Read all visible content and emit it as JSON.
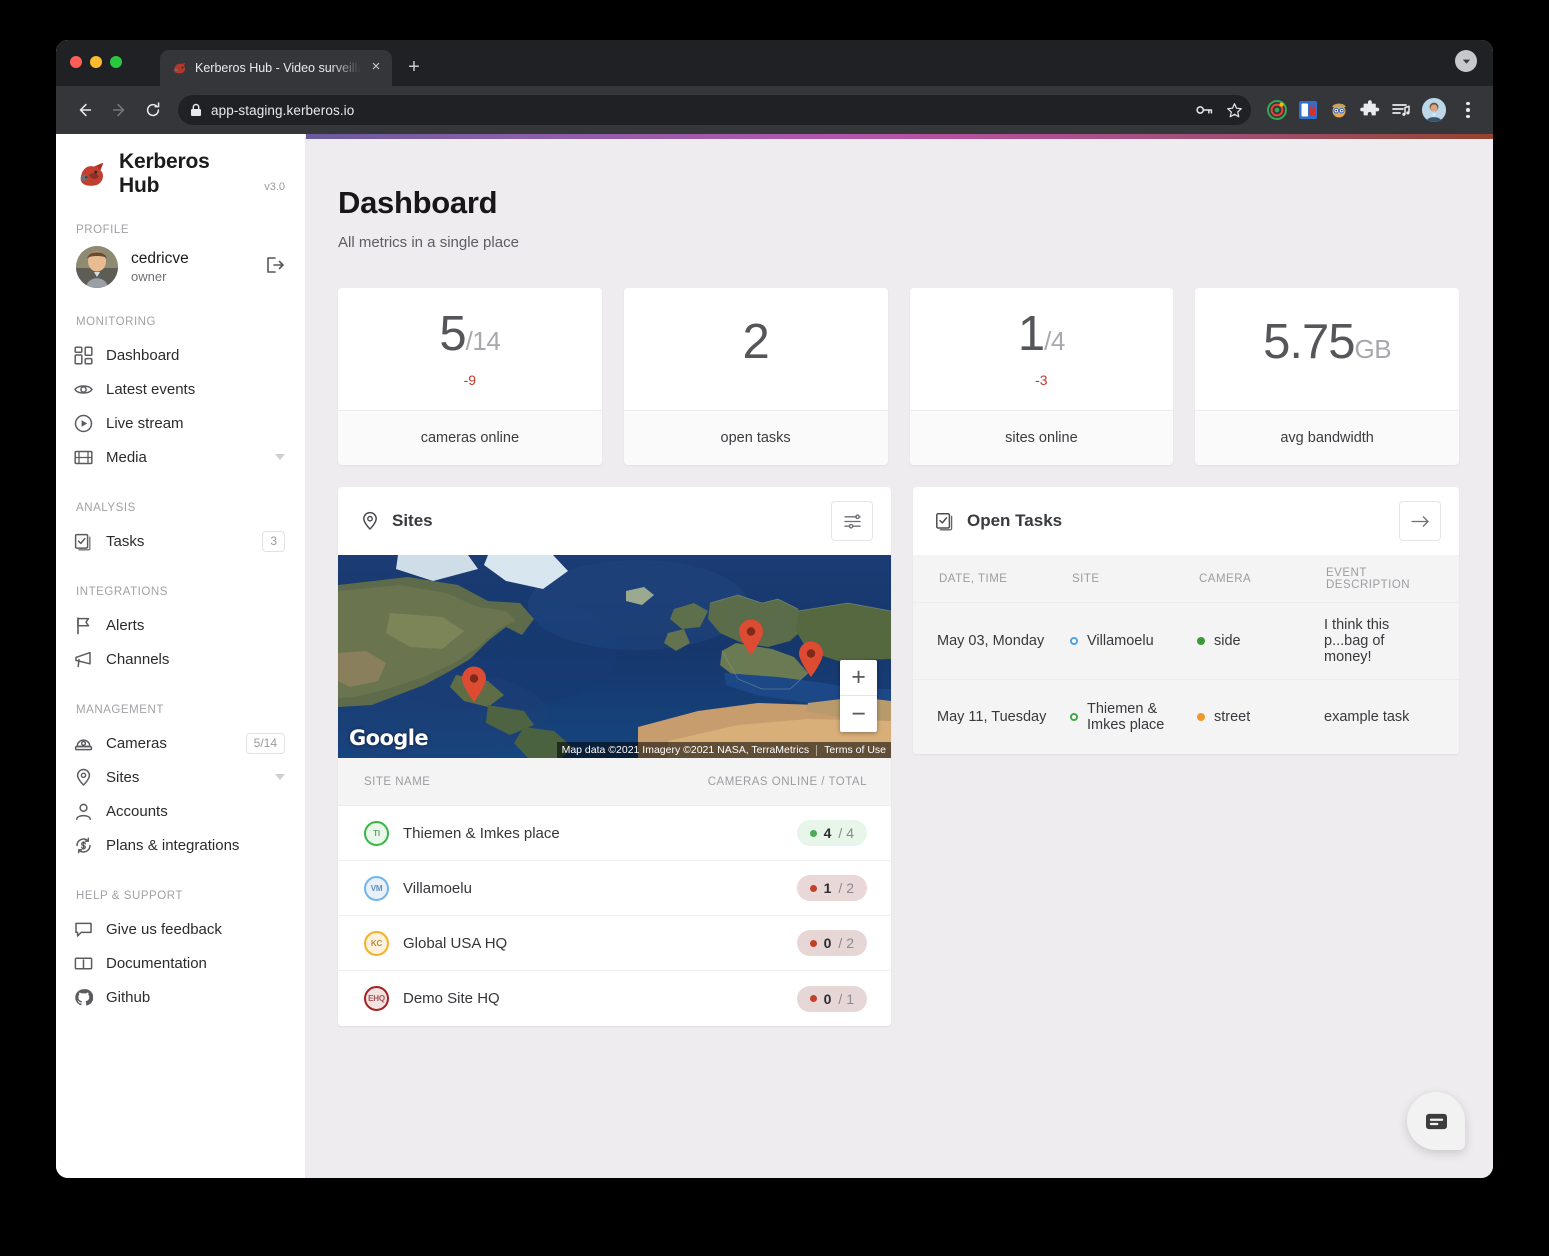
{
  "browser": {
    "tab_title": "Kerberos Hub - Video surveillance",
    "tab_close_label": "×",
    "new_tab_label": "+",
    "url": "app-staging.kerberos.io",
    "back_label": "←",
    "forward_label": "→",
    "reload_label": "↻"
  },
  "sidebar": {
    "brand": {
      "name": "Kerberos Hub",
      "version": "v3.0"
    },
    "sections": [
      {
        "label": "PROFILE",
        "profile": {
          "name": "cedricve",
          "role": "owner"
        }
      },
      {
        "label": "MONITORING",
        "items": [
          {
            "label": "Dashboard",
            "icon": "grid-icon"
          },
          {
            "label": "Latest events",
            "icon": "eye-icon"
          },
          {
            "label": "Live stream",
            "icon": "play-circle-icon"
          },
          {
            "label": "Media",
            "icon": "film-icon",
            "chevron": true
          }
        ]
      },
      {
        "label": "ANALYSIS",
        "items": [
          {
            "label": "Tasks",
            "icon": "task-icon",
            "badge": "3"
          }
        ]
      },
      {
        "label": "INTEGRATIONS",
        "items": [
          {
            "label": "Alerts",
            "icon": "flag-icon"
          },
          {
            "label": "Channels",
            "icon": "megaphone-icon"
          }
        ]
      },
      {
        "label": "MANAGEMENT",
        "items": [
          {
            "label": "Cameras",
            "icon": "camera-icon",
            "badge": "5/14"
          },
          {
            "label": "Sites",
            "icon": "map-pin-icon",
            "chevron": true
          },
          {
            "label": "Accounts",
            "icon": "user-icon"
          },
          {
            "label": "Plans & integrations",
            "icon": "billing-icon"
          }
        ]
      },
      {
        "label": "HELP & SUPPORT",
        "items": [
          {
            "label": "Give us feedback",
            "icon": "chat-icon"
          },
          {
            "label": "Documentation",
            "icon": "book-icon"
          },
          {
            "label": "Github",
            "icon": "github-icon"
          }
        ]
      }
    ]
  },
  "header": {
    "title": "Dashboard",
    "subtitle": "All metrics in a single place"
  },
  "stats": [
    {
      "value": "5",
      "unit": "/14",
      "delta": "-9",
      "label": "cameras online"
    },
    {
      "value": "2",
      "unit": "",
      "delta": "",
      "label": "open tasks"
    },
    {
      "value": "1",
      "unit": "/4",
      "delta": "-3",
      "label": "sites online"
    },
    {
      "value": "5.75",
      "unit": "GB",
      "delta": "",
      "label": "avg bandwidth"
    }
  ],
  "sites_card": {
    "title": "Sites",
    "filter_button_label": "filters",
    "map": {
      "provider": "Google",
      "attribution": "Map data ©2021 Imagery ©2021 NASA, TerraMetrics",
      "terms": "Terms of Use",
      "zoom_in": "+",
      "zoom_out": "−"
    },
    "columns": [
      "SITE NAME",
      "CAMERAS ONLINE / TOTAL"
    ],
    "rows": [
      {
        "initials": "TI",
        "name": "Thiemen & Imkes place",
        "online": "4",
        "total": "/ 4",
        "status": "online",
        "ring": "#3bb54a",
        "bg": "#e7f6e8",
        "fg": "#63a96f"
      },
      {
        "initials": "VM",
        "name": "Villamoelu",
        "online": "1",
        "total": "/ 2",
        "status": "offline",
        "ring": "#6fb5ee",
        "bg": "#e5eef7",
        "fg": "#5f8fbb"
      },
      {
        "initials": "KC",
        "name": "Global USA HQ",
        "online": "0",
        "total": "/ 2",
        "status": "offline",
        "ring": "#f4b12a",
        "bg": "#fbf0db",
        "fg": "#b9893a"
      },
      {
        "initials": "EHQ",
        "name": "Demo Site HQ",
        "online": "0",
        "total": "/ 1",
        "status": "offline",
        "ring": "#a52222",
        "bg": "#f3e3e3",
        "fg": "#a35353"
      }
    ]
  },
  "tasks_card": {
    "title": "Open Tasks",
    "go_button_label": "→",
    "columns": [
      "DATE, TIME",
      "SITE",
      "CAMERA",
      "EVENT DESCRIPTION"
    ],
    "rows": [
      {
        "date": "May 03, Monday",
        "site": "Villamoelu",
        "site_dot": "#4fa3e3",
        "camera": "side",
        "camera_dot": "#3a9a3a",
        "description": "I think this p...bag of money!"
      },
      {
        "date": "May 11, Tuesday",
        "site": "Thiemen & Imkes place",
        "site_dot": "#45a845",
        "camera": "street",
        "camera_dot": "#f0982a",
        "description": "example task"
      }
    ]
  },
  "fab": {
    "label": "chat-bubble"
  },
  "colors": {
    "accent_gradient_start": "#6b5a9e",
    "accent_gradient_end": "#96432f",
    "danger": "#c1382a",
    "page_bg": "#eeecee"
  }
}
